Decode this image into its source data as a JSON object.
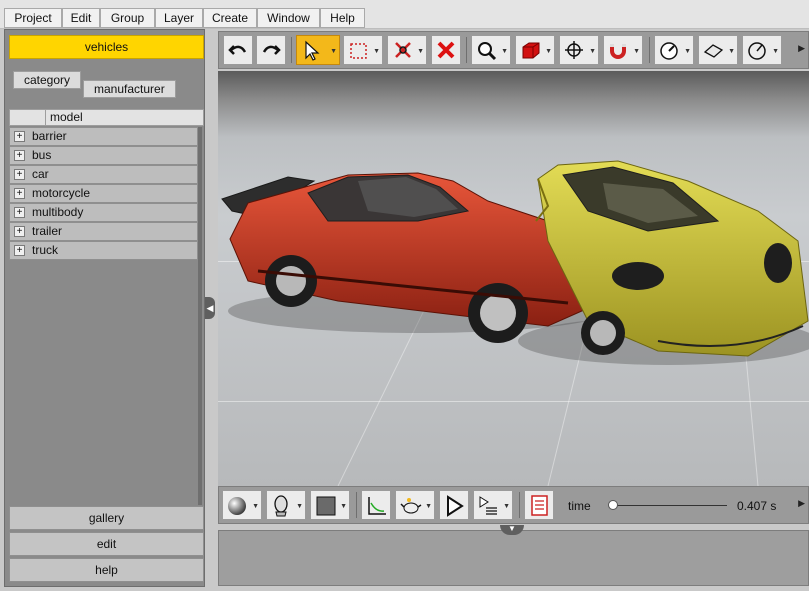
{
  "menu": [
    "Project",
    "Edit",
    "Group",
    "Layer",
    "Create",
    "Window",
    "Help"
  ],
  "left_panel": {
    "active_tab": "vehicles",
    "filters": {
      "category": "category",
      "manufacturer": "manufacturer"
    },
    "column_header": "model",
    "tree_items": [
      "barrier",
      "bus",
      "car",
      "motorcycle",
      "multibody",
      "trailer",
      "truck"
    ],
    "expand_glyph": "+",
    "bottom_buttons": [
      "gallery",
      "edit",
      "help"
    ]
  },
  "toolbar": {
    "icons": [
      "undo-icon",
      "redo-icon",
      "select-pointer-icon",
      "rectangle-select-icon",
      "scissors-icon",
      "delete-x-icon",
      "zoom-icon",
      "red-cube-icon",
      "move-gizmo-icon",
      "magnet-icon",
      "gauge-icon",
      "ruler-plane-icon",
      "dial-icon"
    ]
  },
  "bottom_toolbar": {
    "time_label": "time",
    "time_value": "0.407 s",
    "time_fraction": 0.0
  },
  "colors": {
    "accent": "#ffd500",
    "active_tool": "#f3b81a",
    "red_car": "#c6412a",
    "yellow_car": "#c8c43b"
  }
}
